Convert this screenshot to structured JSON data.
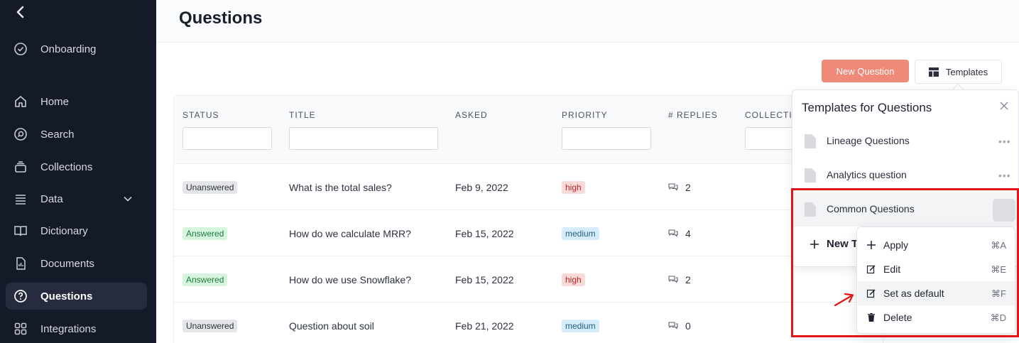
{
  "sidebar": {
    "items": [
      {
        "label": "Onboarding",
        "icon": "check-circle-icon"
      },
      {
        "label": "Home",
        "icon": "home-icon"
      },
      {
        "label": "Search",
        "icon": "search-icon"
      },
      {
        "label": "Collections",
        "icon": "collections-icon"
      },
      {
        "label": "Data",
        "icon": "list-icon"
      },
      {
        "label": "Dictionary",
        "icon": "book-icon"
      },
      {
        "label": "Documents",
        "icon": "document-icon"
      },
      {
        "label": "Questions",
        "icon": "question-icon"
      },
      {
        "label": "Integrations",
        "icon": "grid-icon"
      }
    ]
  },
  "header": {
    "title": "Questions"
  },
  "toolbar": {
    "new_question": "New Question",
    "templates": "Templates"
  },
  "table": {
    "columns": [
      "STATUS",
      "TITLE",
      "ASKED",
      "PRIORITY",
      "# REPLIES",
      "COLLECTI"
    ],
    "rows": [
      {
        "status": "Unanswered",
        "title": "What is the total sales?",
        "asked": "Feb 9, 2022",
        "priority": "high",
        "replies": "2"
      },
      {
        "status": "Answered",
        "title": "How do we calculate MRR?",
        "asked": "Feb 15, 2022",
        "priority": "medium",
        "replies": "4"
      },
      {
        "status": "Answered",
        "title": "How do we use Snowflake?",
        "asked": "Feb 15, 2022",
        "priority": "high",
        "replies": "2"
      },
      {
        "status": "Unanswered",
        "title": "Question about soil",
        "asked": "Feb 21, 2022",
        "priority": "medium",
        "replies": "0"
      }
    ]
  },
  "templates_popover": {
    "title": "Templates for Questions",
    "items": [
      {
        "name": "Lineage Questions"
      },
      {
        "name": "Analytics question"
      },
      {
        "name": "Common Questions"
      }
    ],
    "new_template": "New T"
  },
  "context_menu": {
    "items": [
      {
        "label": "Apply",
        "shortcut": "⌘A",
        "icon": "plus-icon"
      },
      {
        "label": "Edit",
        "shortcut": "⌘E",
        "icon": "edit-icon"
      },
      {
        "label": "Set as default",
        "shortcut": "⌘F",
        "icon": "edit-icon"
      },
      {
        "label": "Delete",
        "shortcut": "⌘D",
        "icon": "trash-icon"
      }
    ]
  },
  "colors": {
    "accent": "#ef8a78",
    "sidebar_bg": "#151a28",
    "highlight": "#e01616"
  }
}
